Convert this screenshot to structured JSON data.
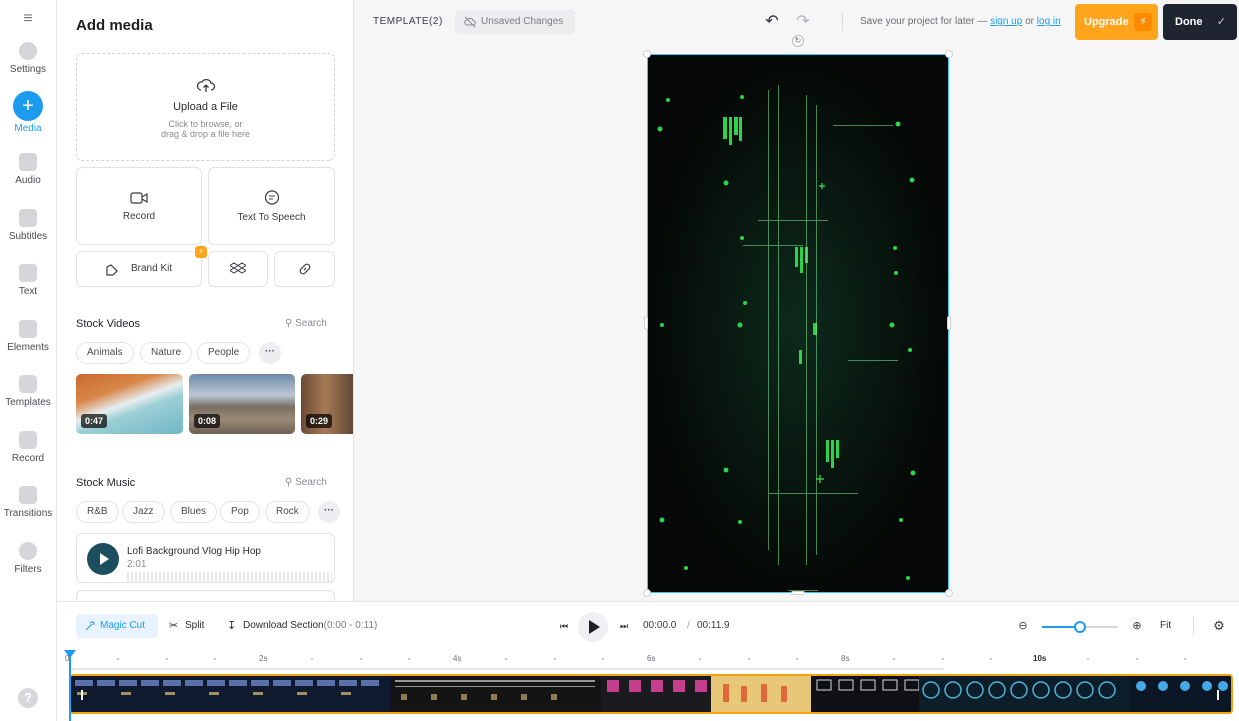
{
  "rail": {
    "items": [
      {
        "label": "Settings",
        "icon": "settings-icon"
      },
      {
        "label": "Media",
        "icon": "plus-icon",
        "active": true
      },
      {
        "label": "Audio",
        "icon": "music-note-icon"
      },
      {
        "label": "Subtitles",
        "icon": "subtitles-icon"
      },
      {
        "label": "Text",
        "icon": "text-icon"
      },
      {
        "label": "Elements",
        "icon": "elements-icon"
      },
      {
        "label": "Templates",
        "icon": "templates-icon"
      },
      {
        "label": "Record",
        "icon": "record-icon"
      },
      {
        "label": "Transitions",
        "icon": "transitions-icon"
      },
      {
        "label": "Filters",
        "icon": "filters-icon"
      }
    ],
    "help": "?"
  },
  "panel": {
    "title": "Add media",
    "upload": {
      "title": "Upload a File",
      "sub1": "Click to browse, or",
      "sub2": "drag & drop a file here"
    },
    "record_label": "Record",
    "tts_label": "Text To Speech",
    "brand_kit_label": "Brand Kit",
    "stock_videos": {
      "title": "Stock Videos",
      "search": "Search",
      "chips": [
        "Animals",
        "Nature",
        "People"
      ],
      "more": "···",
      "thumbs": [
        {
          "duration": "0:47"
        },
        {
          "duration": "0:08"
        },
        {
          "duration": "0:29"
        }
      ]
    },
    "stock_music": {
      "title": "Stock Music",
      "search": "Search",
      "chips": [
        "R&B",
        "Jazz",
        "Blues",
        "Pop",
        "Rock"
      ],
      "more": "···",
      "track": {
        "title": "Lofi Background Vlog Hip Hop",
        "duration": "2:01"
      }
    }
  },
  "topbar": {
    "project_name": "TEMPLATE(2)",
    "unsaved": "Unsaved Changes",
    "save_prefix": "Save your project for later —",
    "sign_up": "sign up",
    "or": "or",
    "log_in": "log in",
    "upgrade": "Upgrade",
    "done": "Done"
  },
  "timeline": {
    "magic_cut": "Magic Cut",
    "split": "Split",
    "download_section": "Download Section",
    "download_range": "(0:00 - 0:11)",
    "current_time": "00:00.0",
    "separator": "/",
    "total_time": "00:11.9",
    "zoom_level": 0.5,
    "fit": "Fit",
    "ruler_labels": [
      "0",
      "2s",
      "4s",
      "6s",
      "8s",
      "10s"
    ]
  },
  "colors": {
    "accent": "#1c9bf0",
    "upgrade": "#ffa41b",
    "done": "#1e2430",
    "track_border": "#f2a30f",
    "video_glow": "#2bd44a"
  }
}
